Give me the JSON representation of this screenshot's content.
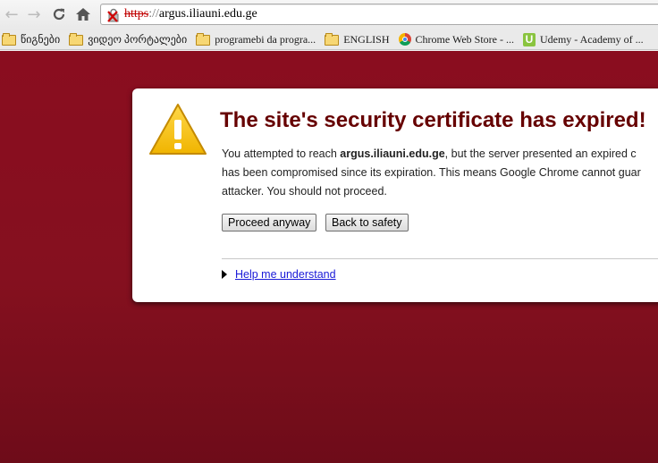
{
  "toolbar": {
    "back_icon": "back-arrow-icon",
    "forward_icon": "forward-arrow-icon",
    "reload_icon": "reload-icon",
    "home_icon": "home-icon",
    "url_scheme": "https",
    "url_separator": "://",
    "url_host": "argus.iliauni.edu.ge"
  },
  "bookmarks": [
    {
      "label": "წიგნები",
      "icon": "folder-icon"
    },
    {
      "label": "ვიდეო პორტალები",
      "icon": "folder-icon"
    },
    {
      "label": "programebi da progra...",
      "icon": "folder-icon"
    },
    {
      "label": "ENGLISH",
      "icon": "folder-icon"
    },
    {
      "label": "Chrome Web Store - ...",
      "icon": "chrome-web-store-icon"
    },
    {
      "label": "Udemy - Academy of ...",
      "icon": "udemy-icon"
    }
  ],
  "error": {
    "title": "The site's security certificate has expired!",
    "line1_prefix": "You attempted to reach ",
    "line1_host": "argus.iliauni.edu.ge",
    "line1_suffix": ", but the server presented an expired c",
    "line2": "has been compromised since its expiration. This means Google Chrome cannot guar",
    "line3": "attacker. You should not proceed.",
    "proceed_label": "Proceed anyway",
    "back_label": "Back to safety",
    "help_label": "Help me understand"
  },
  "colors": {
    "page_background": "#85101f",
    "title": "#660000",
    "link": "#1a1ad8",
    "warning_icon": "#f5c000"
  }
}
